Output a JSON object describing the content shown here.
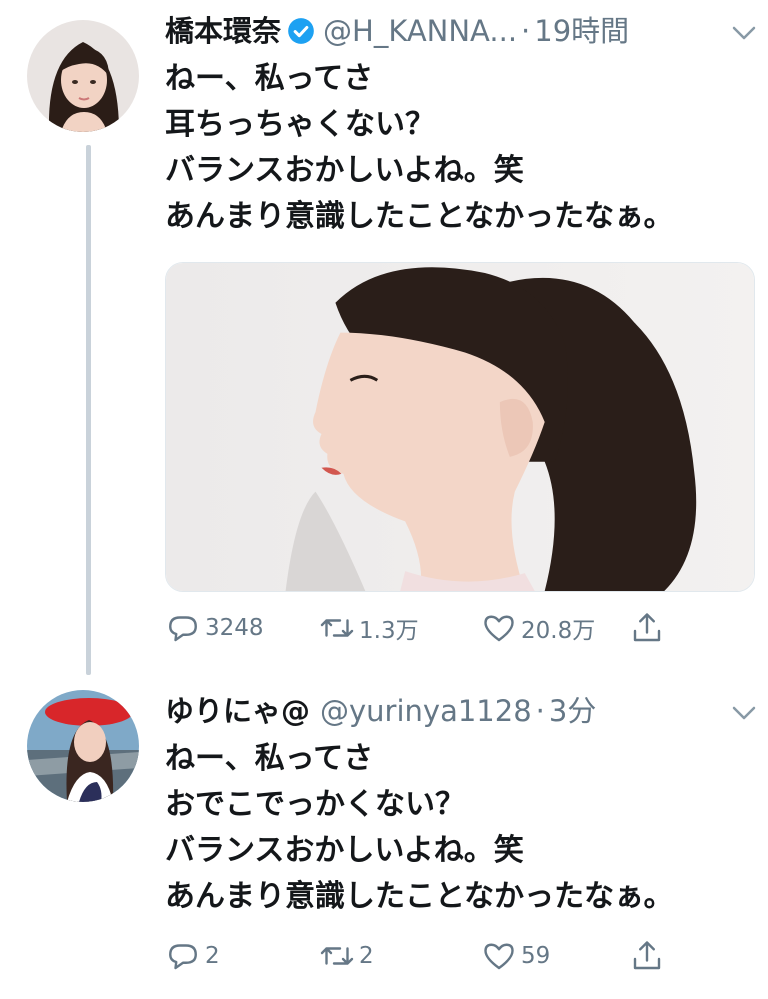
{
  "thread": [
    {
      "author": {
        "name": "橋本環奈",
        "handle": "@H_KANNA...",
        "separator": "·",
        "time": "19時間",
        "verified": true,
        "avatar_icon": "avatar-photo"
      },
      "lines": [
        "ねー、私ってさ",
        "耳ちっちゃくない？",
        "バランスおかしいよね。笑",
        "あんまり意識したことなかったなぁ。"
      ],
      "media": {
        "type": "photo",
        "description_icon": "profile-photo"
      },
      "actions": {
        "reply": "3248",
        "retweet": "1.3万",
        "like": "20.8万"
      }
    },
    {
      "author": {
        "name": "ゆりにゃ@",
        "handle": "@yurinya1128",
        "separator": "·",
        "time": "3分",
        "verified": false,
        "avatar_icon": "avatar-photo"
      },
      "lines": [
        "ねー、私ってさ",
        "おでこでっかくない？",
        "バランスおかしいよね。笑",
        "あんまり意識したことなかったなぁ。"
      ],
      "actions": {
        "reply": "2",
        "retweet": "2",
        "like": "59"
      }
    }
  ],
  "colors": {
    "text": "#14171a",
    "secondary": "#657786",
    "verified": "#1da1f2",
    "thread_line": "#c9d2da"
  }
}
